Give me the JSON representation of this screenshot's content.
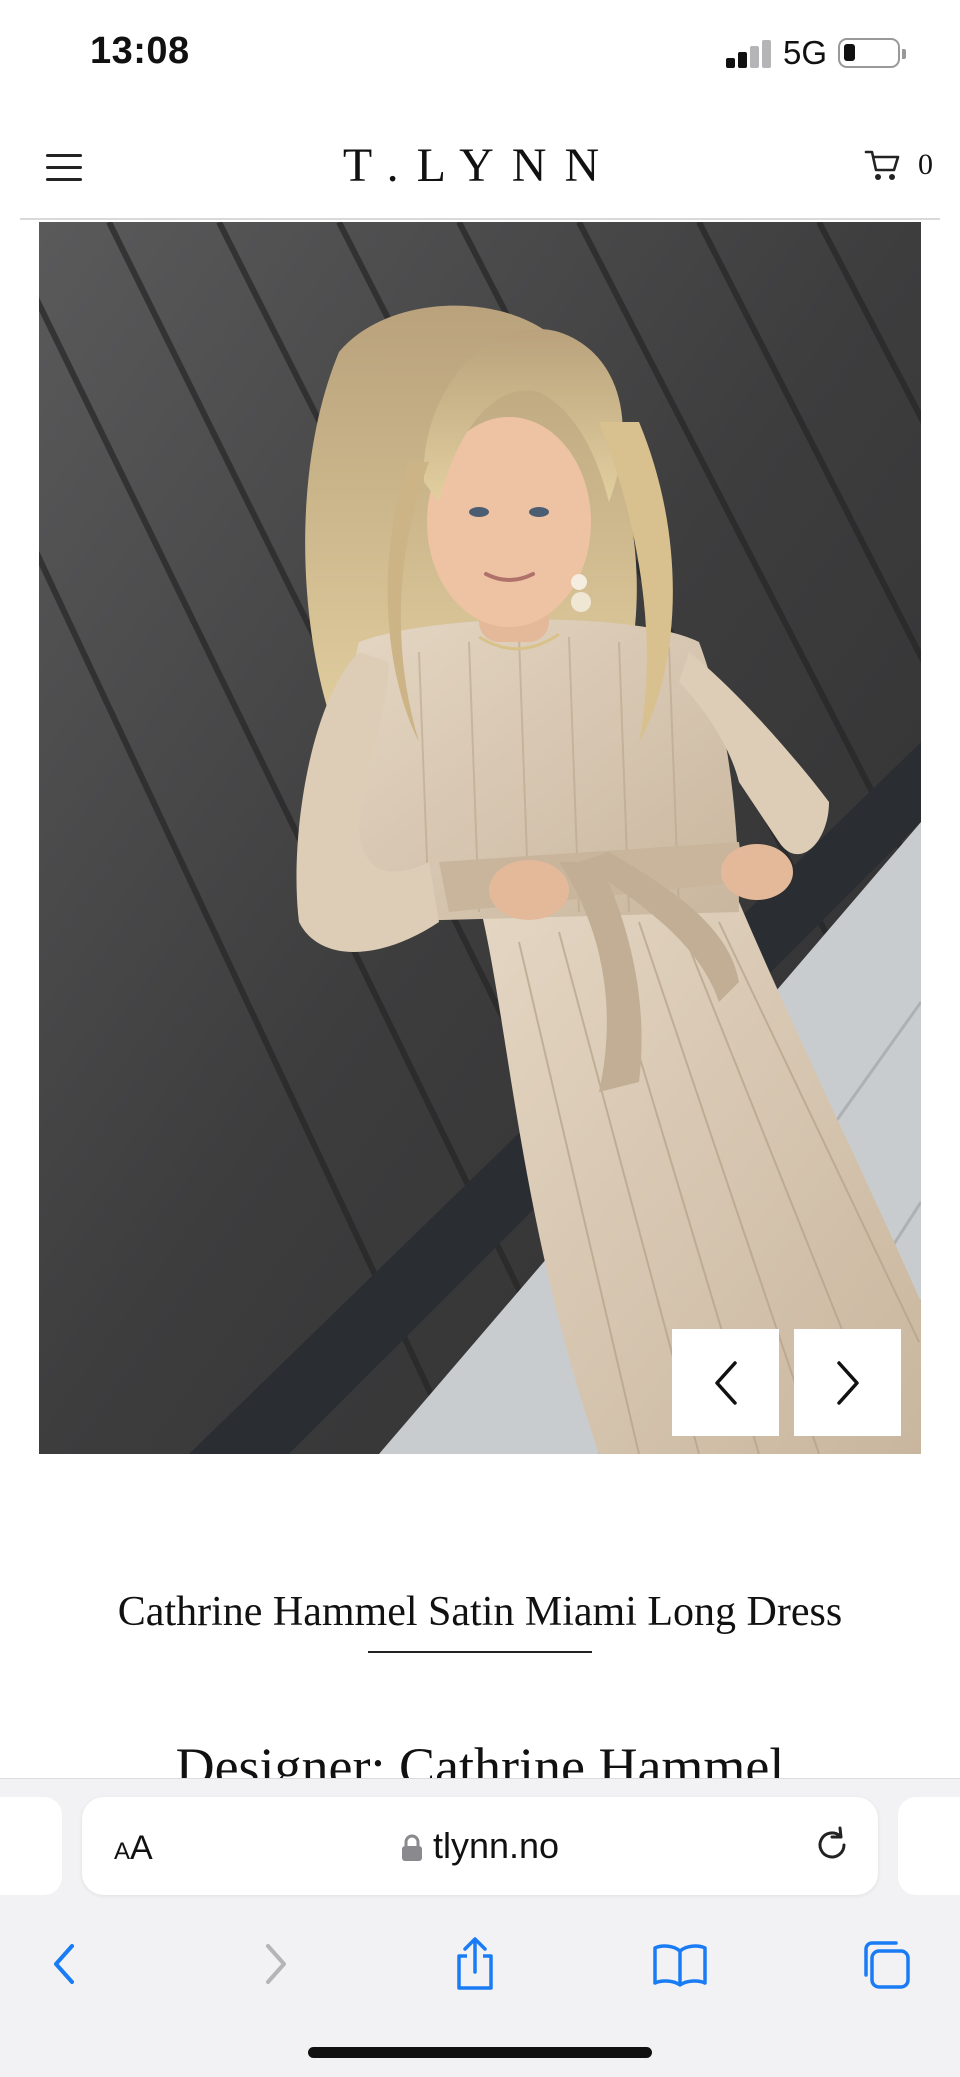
{
  "status_bar": {
    "time": "13:08",
    "network": "5G",
    "icons": [
      "signal-icon",
      "battery-icon"
    ]
  },
  "header": {
    "logo": "T.LYNN",
    "cart_count": "0",
    "icons": [
      "menu-icon",
      "cart-icon"
    ]
  },
  "gallery": {
    "image_description_icon": "product-photo",
    "prev_icon": "chevron-left-icon",
    "next_icon": "chevron-right-icon"
  },
  "product": {
    "title": "Cathrine Hammel Satin Miami Long Dress",
    "designer": "Designer: Cathrine Hammel"
  },
  "browser": {
    "text_size_label": "AA",
    "url": "tlynn.no",
    "icons": [
      "lock-icon",
      "reload-icon",
      "back-icon",
      "forward-icon",
      "share-icon",
      "bookmarks-icon",
      "tabs-icon"
    ]
  },
  "colors": {
    "accent": "#1a7cf5",
    "disabled": "#b5b5b8",
    "text": "#111111",
    "photo_wall": "#3e3e3f",
    "dress": "#d9c8b2"
  }
}
